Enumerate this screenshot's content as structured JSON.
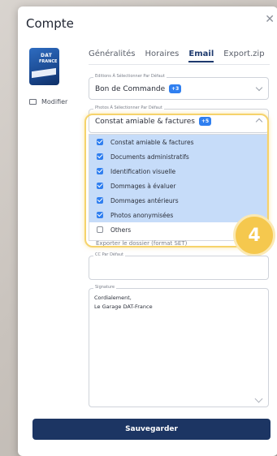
{
  "modal": {
    "title": "Compte",
    "close_icon": "close-icon"
  },
  "profile": {
    "logo_line1": "DAT",
    "logo_line2": "FRANCE",
    "modify_label": "Modifier",
    "modify_icon": "camera-icon"
  },
  "tabs": [
    {
      "label": "Généralités",
      "active": false
    },
    {
      "label": "Horaires",
      "active": false
    },
    {
      "label": "Email",
      "active": true
    },
    {
      "label": "Export.zip",
      "active": false
    }
  ],
  "editions": {
    "label": "Editions À Sélectionner Par Défaut",
    "value": "Bon de Commande",
    "badge": "+3"
  },
  "photos": {
    "label": "Photos À Sélectionner Par Défaut",
    "value": "Constat amiable & factures",
    "badge": "+5",
    "options": [
      {
        "label": "Constat amiable & factures",
        "checked": true
      },
      {
        "label": "Documents administratifs",
        "checked": true
      },
      {
        "label": "Identification visuelle",
        "checked": true
      },
      {
        "label": "Dommages à évaluer",
        "checked": true
      },
      {
        "label": "Dommages antérieurs",
        "checked": true
      },
      {
        "label": "Photos anonymisées",
        "checked": true
      },
      {
        "label": "Others",
        "checked": false
      }
    ]
  },
  "partially_hidden_text": "Exporter le dossier (format SET)",
  "cc": {
    "label": "CC Par Défaut",
    "value": ""
  },
  "signature": {
    "label": "Signature",
    "value": "Cordialement,\nLe Garage DAT-France"
  },
  "step_badge": "4",
  "save_label": "Sauvegarder",
  "colors": {
    "primary": "#1c3563",
    "accent": "#2f7ff0",
    "highlight": "#f5c84e",
    "selected_row": "#c6dcf9"
  }
}
